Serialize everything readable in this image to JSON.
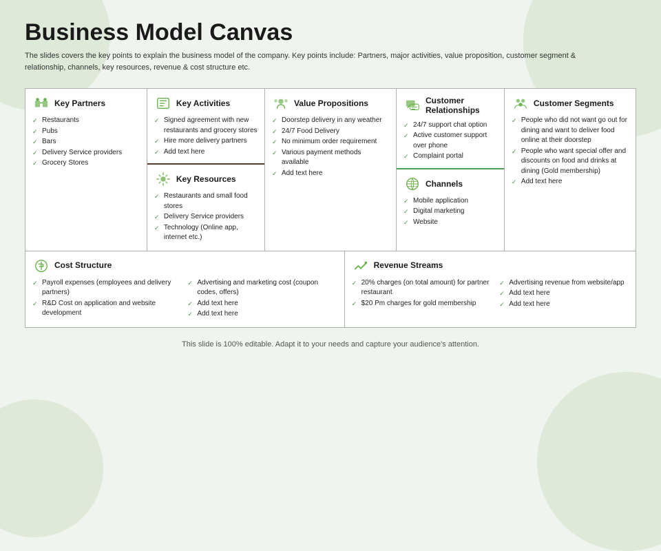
{
  "page": {
    "title": "Business Model Canvas",
    "subtitle": "The slides covers the key points to explain the business model of the company. Key points include: Partners, major activities, value proposition, customer segment & relationship, channels, key resources, revenue & cost structure etc.",
    "footer": "This slide is 100% editable. Adapt it to your needs and capture your audience's attention."
  },
  "sections": {
    "key_partners": {
      "title": "Key Partners",
      "items": [
        "Restaurants",
        "Pubs",
        "Bars",
        "Delivery Service providers",
        "Grocery Stores"
      ]
    },
    "key_activities": {
      "title": "Key Activities",
      "items": [
        "Signed agreement with new restaurants and grocery stores",
        "Hire more delivery partners",
        "Add text here"
      ]
    },
    "key_resources": {
      "title": "Key Resources",
      "items": [
        "Restaurants and small food stores",
        "Delivery Service providers",
        "Technology (Online app, internet etc.)"
      ]
    },
    "value_propositions": {
      "title": "Value Propositions",
      "items": [
        "Doorstep delivery in any weather",
        "24/7 Food Delivery",
        "No minimum order requirement",
        "Various payment methods available",
        "Add text here"
      ]
    },
    "customer_relationships": {
      "title": "Customer Relationships",
      "items": [
        "24/7 support chat option",
        "Active customer support over phone",
        "Complaint portal"
      ]
    },
    "channels": {
      "title": "Channels",
      "items": [
        "Mobile application",
        "Digital marketing",
        "Website"
      ]
    },
    "customer_segments": {
      "title": "Customer Segments",
      "items": [
        "People who did not want go out for dining and want to deliver food online at their doorstep",
        "People who want special offer and discounts on food and drinks at dining (Gold membership)",
        "Add text here"
      ]
    },
    "cost_structure": {
      "title": "Cost Structure",
      "col1": [
        "Payroll expenses (employees and delivery partners)",
        "R&D Cost on application and website development"
      ],
      "col2": [
        "Advertising and marketing cost (coupon codes, offers)",
        "Add text here",
        "Add text here"
      ]
    },
    "revenue_streams": {
      "title": "Revenue Streams",
      "col1": [
        "20% charges (on total amount) for partner restaurant",
        "$20 Pm charges for gold membership"
      ],
      "col2": [
        "Advertising revenue from website/app",
        "Add text here",
        "Add text here"
      ]
    }
  }
}
